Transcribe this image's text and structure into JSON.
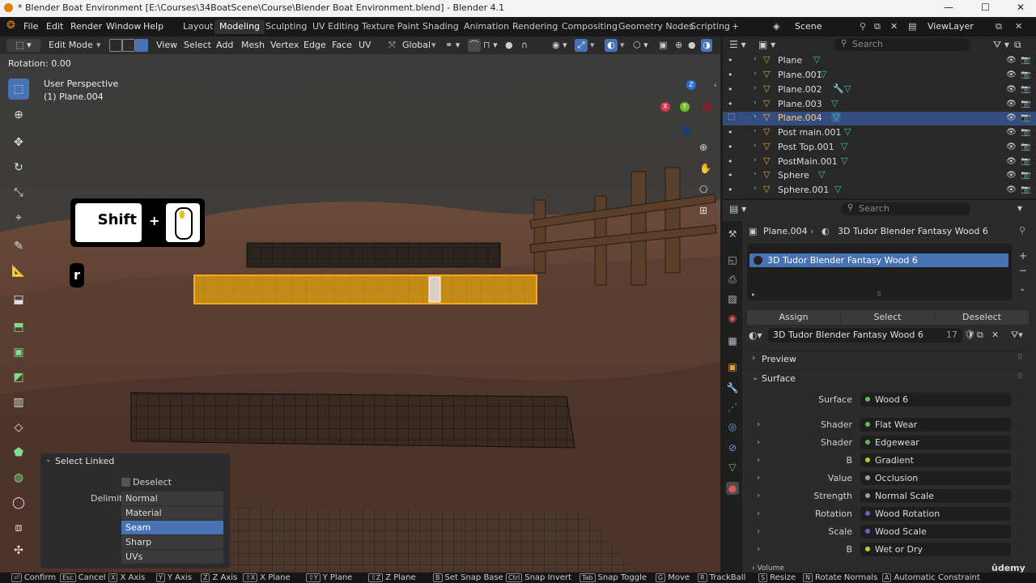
{
  "window": {
    "title": "* Blender Boat Environment [E:\\Courses\\34BoatScene\\Course\\Blender Boat Environment.blend] - Blender 4.1",
    "minimize": "—",
    "maximize": "☐",
    "close": "✕"
  },
  "menu": [
    "File",
    "Edit",
    "Render",
    "Window",
    "Help"
  ],
  "workspaces": [
    "Layout",
    "Modeling",
    "Sculpting",
    "UV Editing",
    "Texture Paint",
    "Shading",
    "Animation",
    "Rendering",
    "Compositing",
    "Geometry Nodes",
    "Scripting"
  ],
  "active_workspace": "Modeling",
  "add_workspace": "+",
  "scene": {
    "label": "Scene",
    "view_layer": "ViewLayer"
  },
  "header": {
    "mode": "Edit Mode",
    "menus": [
      "View",
      "Select",
      "Add",
      "Mesh",
      "Vertex",
      "Edge",
      "Face",
      "UV"
    ],
    "orientation": "Global"
  },
  "viewport": {
    "operator_status": "Rotation: 0.00",
    "perspective": "User Perspective",
    "object": "(1) Plane.004",
    "keys": {
      "shift": "Shift",
      "plus": "+",
      "r": "r"
    },
    "gizmo": {
      "x": "X",
      "y": "Y",
      "z": "Z"
    }
  },
  "select_linked_panel": {
    "title": "Select Linked",
    "deselect_label": "Deselect",
    "delimit_label": "Delimit",
    "options": [
      "Normal",
      "Material",
      "Seam",
      "Sharp",
      "UVs"
    ],
    "selected": "Seam"
  },
  "outliner": {
    "search_placeholder": "Search",
    "items": [
      {
        "name": "Plane",
        "selected": false
      },
      {
        "name": "Plane.001",
        "selected": false
      },
      {
        "name": "Plane.002",
        "selected": false
      },
      {
        "name": "Plane.003",
        "selected": false
      },
      {
        "name": "Plane.004",
        "selected": true
      },
      {
        "name": "Post main.001",
        "selected": false
      },
      {
        "name": "Post Top.001",
        "selected": false
      },
      {
        "name": "PostMain.001",
        "selected": false
      },
      {
        "name": "Sphere",
        "selected": false
      },
      {
        "name": "Sphere.001",
        "selected": false
      }
    ]
  },
  "properties": {
    "search_placeholder": "Search",
    "breadcrumb_object": "Plane.004",
    "breadcrumb_material": "3D Tudor Blender Fantasy Wood 6",
    "slot": "3D Tudor Blender Fantasy Wood 6",
    "assign": "Assign",
    "select": "Select",
    "deselect": "Deselect",
    "material_name": "3D Tudor Blender Fantasy Wood 6",
    "user_count": "17",
    "preview_section": "Preview",
    "surface_section": "Surface",
    "rows": [
      {
        "label": "Surface",
        "value": "Wood 6",
        "color": "#5fbf5f",
        "expandable": false
      },
      {
        "label": "Shader",
        "value": "Flat Wear",
        "color": "#5fbf5f",
        "expandable": true
      },
      {
        "label": "Shader",
        "value": "Edgewear",
        "color": "#5fbf5f",
        "expandable": true
      },
      {
        "label": "B",
        "value": "Gradient",
        "color": "#c7c729",
        "expandable": true
      },
      {
        "label": "Value",
        "value": "Occlusion",
        "color": "#a1a1a1",
        "expandable": true
      },
      {
        "label": "Strength",
        "value": "Normal Scale",
        "color": "#a1a1a1",
        "expandable": true
      },
      {
        "label": "Rotation",
        "value": "Wood Rotation",
        "color": "#6363c7",
        "expandable": true
      },
      {
        "label": "Scale",
        "value": "Wood Scale",
        "color": "#6363c7",
        "expandable": true
      },
      {
        "label": "B",
        "value": "Wet or Dry",
        "color": "#c7c729",
        "expandable": true
      }
    ],
    "volume_section": "Volume"
  },
  "statusbar": [
    {
      "key": "⏎",
      "label": "Confirm"
    },
    {
      "key": "Esc",
      "label": "Cancel"
    },
    {
      "key": "X",
      "label": "X Axis"
    },
    {
      "key": "Y",
      "label": "Y Axis"
    },
    {
      "key": "Z",
      "label": "Z Axis"
    },
    {
      "key": "⇧X",
      "label": "X Plane"
    },
    {
      "key": "⇧Y",
      "label": "Y Plane"
    },
    {
      "key": "⇧Z",
      "label": "Z Plane"
    },
    {
      "key": "B",
      "label": "Set Snap Base"
    },
    {
      "key": "Ctrl",
      "label": "Snap Invert"
    },
    {
      "key": "Tab",
      "label": "Snap Toggle"
    },
    {
      "key": "G",
      "label": "Move"
    },
    {
      "key": "R",
      "label": "TrackBall"
    },
    {
      "key": "S",
      "label": "Resize"
    },
    {
      "key": "N",
      "label": "Rotate Normals"
    },
    {
      "key": "A",
      "label": "Automatic Constraint"
    }
  ],
  "watermark": "ûdemy"
}
